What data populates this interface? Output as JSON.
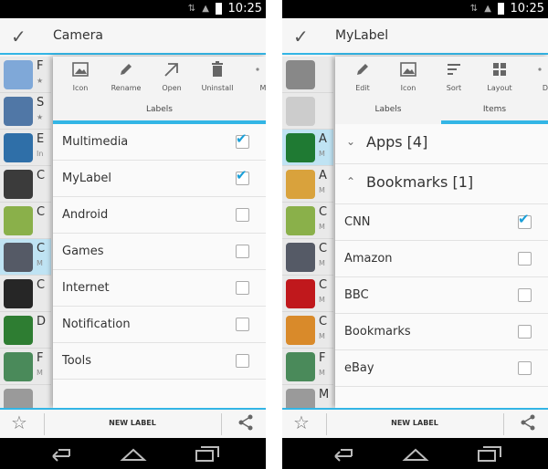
{
  "status": {
    "time": "10:25"
  },
  "left": {
    "title": "Camera",
    "app_list": [
      {
        "initial": "F",
        "sub": "★",
        "color": "#7fa8d8",
        "selected": false
      },
      {
        "initial": "S",
        "sub": "★",
        "color": "#5077a6",
        "selected": false
      },
      {
        "initial": "E",
        "sub": "In",
        "color": "#2f6fa8",
        "selected": false
      },
      {
        "initial": "C",
        "sub": "",
        "color": "#3b3b3b",
        "selected": false
      },
      {
        "initial": "C",
        "sub": "",
        "color": "#8ab04a",
        "selected": false
      },
      {
        "initial": "C",
        "sub": "M",
        "color": "#555a66",
        "selected": true
      },
      {
        "initial": "C",
        "sub": "",
        "color": "#262626",
        "selected": false
      },
      {
        "initial": "D",
        "sub": "",
        "color": "#2e7d32",
        "selected": false
      },
      {
        "initial": "F",
        "sub": "M",
        "color": "#4a8a5a",
        "selected": false
      },
      {
        "initial": "",
        "sub": "",
        "color": "#9a9a9a",
        "selected": false
      }
    ],
    "tools": [
      {
        "label": "Icon",
        "icon": "image-icon"
      },
      {
        "label": "Rename",
        "icon": "pencil-icon"
      },
      {
        "label": "Open",
        "icon": "launch-icon"
      },
      {
        "label": "Uninstall",
        "icon": "trash-icon"
      },
      {
        "label": "M",
        "icon": "more-icon"
      }
    ],
    "tab": "Labels",
    "labels": [
      {
        "name": "Multimedia",
        "checked": true
      },
      {
        "name": "MyLabel",
        "checked": true
      },
      {
        "name": "Android",
        "checked": false
      },
      {
        "name": "Games",
        "checked": false
      },
      {
        "name": "Internet",
        "checked": false
      },
      {
        "name": "Notification",
        "checked": false
      },
      {
        "name": "Tools",
        "checked": false
      }
    ],
    "new_label": "NEW LABEL"
  },
  "right": {
    "title": "MyLabel",
    "app_list": [
      {
        "initial": "",
        "sub": "",
        "color": "#888888",
        "selected": false
      },
      {
        "initial": "",
        "sub": "",
        "color": "#cccccc",
        "selected": false
      },
      {
        "initial": "A",
        "sub": "M",
        "color": "#1f7a33",
        "selected": true
      },
      {
        "initial": "A",
        "sub": "M",
        "color": "#d9a23c",
        "selected": false
      },
      {
        "initial": "C",
        "sub": "M",
        "color": "#8ab04a",
        "selected": false
      },
      {
        "initial": "C",
        "sub": "M",
        "color": "#555a66",
        "selected": false
      },
      {
        "initial": "C",
        "sub": "M",
        "color": "#c0181c",
        "selected": false
      },
      {
        "initial": "C",
        "sub": "M",
        "color": "#d98a2a",
        "selected": false
      },
      {
        "initial": "F",
        "sub": "M",
        "color": "#4a8a5a",
        "selected": false
      },
      {
        "initial": "M",
        "sub": "",
        "color": "#9a9a9a",
        "selected": false
      }
    ],
    "tools": [
      {
        "label": "Edit",
        "icon": "pencil-icon"
      },
      {
        "label": "Icon",
        "icon": "image-icon"
      },
      {
        "label": "Sort",
        "icon": "sort-icon"
      },
      {
        "label": "Layout",
        "icon": "grid-icon"
      },
      {
        "label": "D",
        "icon": "more-icon"
      }
    ],
    "tabs": [
      "Labels",
      "Items"
    ],
    "groups": [
      {
        "name": "Apps [4]",
        "expanded": false
      },
      {
        "name": "Bookmarks [1]",
        "expanded": true
      }
    ],
    "items": [
      {
        "name": "CNN",
        "checked": true
      },
      {
        "name": "Amazon",
        "checked": false
      },
      {
        "name": "BBC",
        "checked": false
      },
      {
        "name": "Bookmarks",
        "checked": false
      },
      {
        "name": "eBay",
        "checked": false
      }
    ],
    "new_label": "NEW LABEL"
  },
  "colors": {
    "accent": "#33b5e5",
    "check": "#1a9fd8"
  }
}
